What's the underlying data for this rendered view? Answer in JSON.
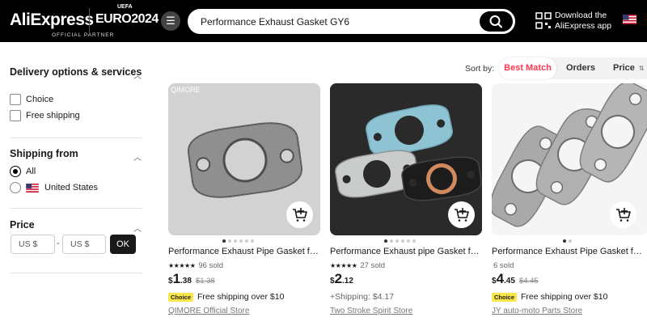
{
  "header": {
    "logo": "AliExpress",
    "partner_text": "OFFICIAL PARTNER",
    "euro_text": "EURO2024",
    "uefa_text": "UEFA",
    "search_value": "Performance Exhaust Gasket GY6",
    "download_line1": "Download the",
    "download_line2": "AliExpress app"
  },
  "sidebar": {
    "delivery_title": "Delivery options & services",
    "delivery_options": [
      "Choice",
      "Free shipping"
    ],
    "shipping_title": "Shipping from",
    "shipping_options": [
      "All",
      "United States"
    ],
    "price_title": "Price",
    "price_min_placeholder": "US $",
    "price_max_placeholder": "US $",
    "price_sep": "-",
    "ok_label": "OK"
  },
  "sort": {
    "label": "Sort by:",
    "tabs": [
      "Best Match",
      "Orders",
      "Price"
    ]
  },
  "products": [
    {
      "title": "Performance Exhaust Pipe Gasket for ...",
      "stars": "★★★★★",
      "sold": "96 sold",
      "currency": "$",
      "price_main": "1",
      "price_dec": ".38",
      "price_old": "$1.38",
      "choice": "Choice",
      "shipping": "Free shipping over $10",
      "store": "QIMORE Official Store",
      "watermark": "QIMORE"
    },
    {
      "title": "Performance Exhaust pipe Gasket for ...",
      "stars": "★★★★★",
      "sold": "27 sold",
      "currency": "$",
      "price_main": "2",
      "price_dec": ".12",
      "price_old": "",
      "choice": "",
      "shipping": "+Shipping: $4.17",
      "store": "Two Stroke Spirit Store"
    },
    {
      "title": "Performance Exhaust Pipe Gasket for ...",
      "stars": "",
      "sold": "6 sold",
      "currency": "$",
      "price_main": "4",
      "price_dec": ".45",
      "price_old": "$4.45",
      "choice": "Choice",
      "shipping": "Free shipping over $10",
      "store": "JY auto-moto Parts Store"
    }
  ],
  "colors": {
    "accent": "#fd384f",
    "choice_badge": "#fbe64a",
    "header_bg": "#000000"
  }
}
